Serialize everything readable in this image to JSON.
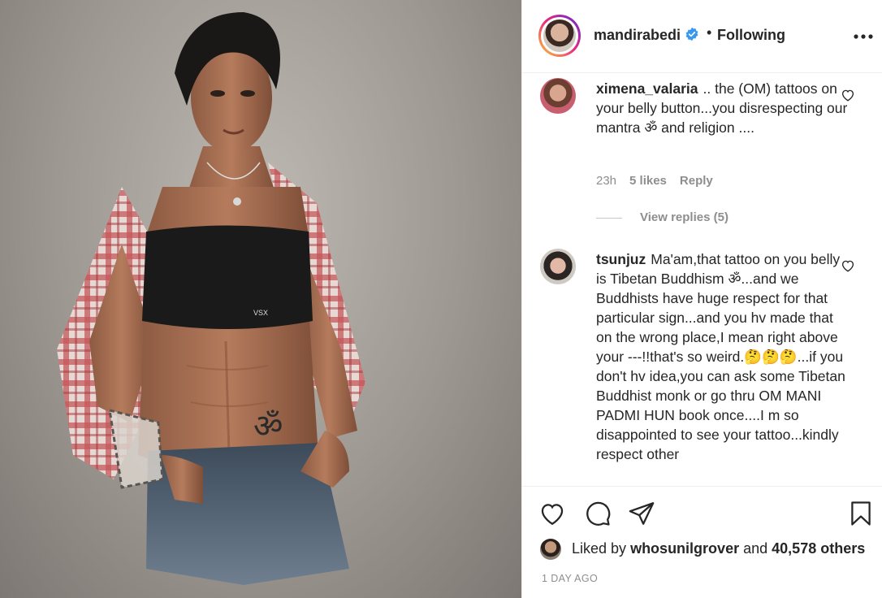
{
  "post": {
    "owner": "mandirabedi",
    "follow_separator": "•",
    "follow_status": "Following",
    "image_tattoo_text": "ॐ",
    "image_brand_text": "VSX"
  },
  "comments": [
    {
      "username": "ximena_valaria",
      "text": ".. the (OM) tattoos on your belly button...you disrespecting our mantra ॐ and religion ....",
      "time": "23h",
      "likes": "5 likes",
      "reply": "Reply",
      "view_replies": "View replies (5)"
    },
    {
      "username": "tsunjuz",
      "text": "Ma'am,that tattoo on you belly is Tibetan Buddhism ॐ...and we Buddhists have huge respect for that particular sign...and you hv made that on the wrong place,I mean right above your ---!!that's so weird.🤔🤔🤔...if you don't hv idea,you can ask some Tibetan Buddhist monk or go thru OM MANI PADMI HUN book once....I m so disappointed to see your tattoo...kindly respect other"
    }
  ],
  "likes": {
    "prefix": "Liked by",
    "user": "whosunilgrover",
    "and": "and",
    "count": "40,578 others"
  },
  "timestamp": "1 DAY AGO",
  "icons": {
    "like": "heart-icon",
    "comment": "comment-bubble-icon",
    "share": "paper-plane-icon",
    "save": "bookmark-icon",
    "verified": "verified-badge-icon",
    "more": "more-options-icon"
  },
  "colors": {
    "text": "#262626",
    "muted": "#8e8e8e",
    "verified": "#3897f0",
    "border": "#efefef"
  }
}
